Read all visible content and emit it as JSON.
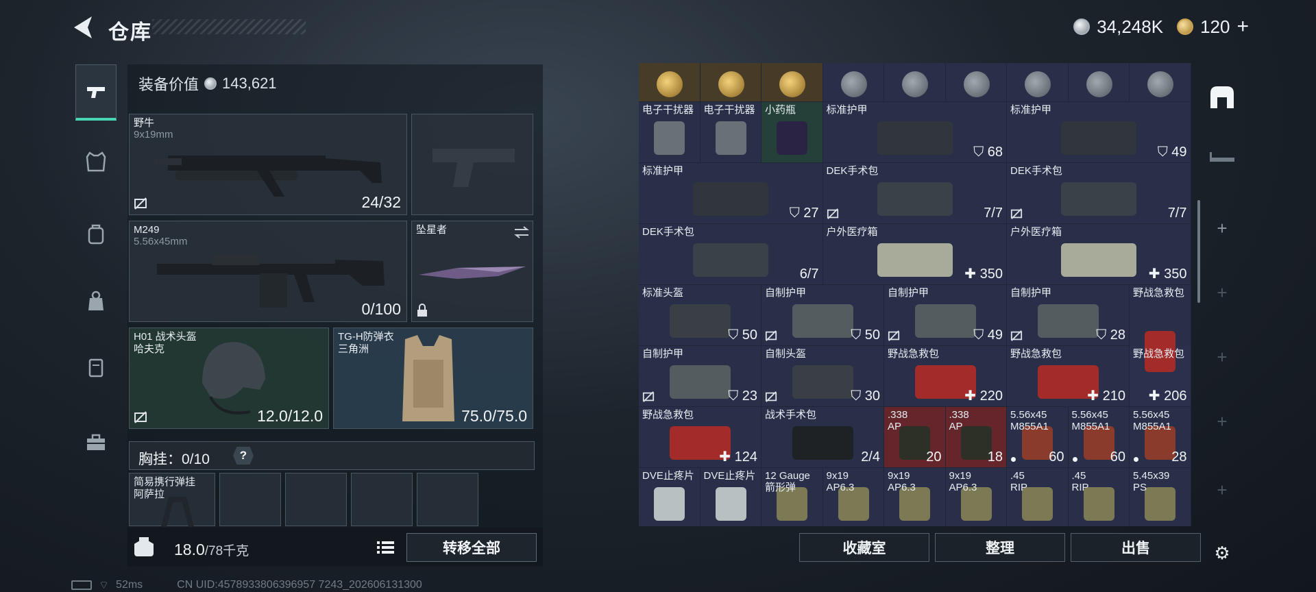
{
  "header": {
    "title": "仓库",
    "currency": {
      "coins": "34,248K",
      "gold": "120"
    }
  },
  "equipment": {
    "value_label": "装备价值",
    "value": "143,621",
    "primary": {
      "name": "野牛",
      "caliber": "9x19mm",
      "ammo": "24/32"
    },
    "secondary": {
      "name": "M249",
      "caliber": "5.56x45mm",
      "ammo": "0/100"
    },
    "melee": {
      "name": "坠星者"
    },
    "helmet": {
      "name": "H01 战术头盔",
      "brand": "哈夫克",
      "durability": "12.0/12.0"
    },
    "armor": {
      "name": "TG-H防弹衣",
      "brand": "三角洲",
      "durability": "75.0/75.0"
    },
    "chest": {
      "label": "胸挂：",
      "capacity": "0/10",
      "help": "?"
    },
    "chest_slot": {
      "name": "简易携行弹挂",
      "brand": "阿萨拉"
    },
    "weight": "18.0",
    "weight_max": "/78千克",
    "transfer_all": "转移全部"
  },
  "storage": {
    "row1": [
      "",
      "",
      "",
      "",
      "",
      "",
      "",
      "",
      ""
    ],
    "items": [
      {
        "name": "电子干扰器",
        "value": ""
      },
      {
        "name": "电子干扰器",
        "value": ""
      },
      {
        "name": "小药瓶",
        "value": ""
      },
      {
        "name": "标准护甲",
        "value": "68"
      },
      {
        "name": "标准护甲",
        "value": "49"
      },
      {
        "name": "标准护甲",
        "value": "27"
      },
      {
        "name": "DEK手术包",
        "value": "7/7"
      },
      {
        "name": "DEK手术包",
        "value": "7/7"
      },
      {
        "name": "DEK手术包",
        "value": "6/7"
      },
      {
        "name": "户外医疗箱",
        "value": "350"
      },
      {
        "name": "户外医疗箱",
        "value": "350"
      },
      {
        "name": "标准头盔",
        "value": "50"
      },
      {
        "name": "自制护甲",
        "value": "50"
      },
      {
        "name": "自制护甲",
        "value": "49"
      },
      {
        "name": "自制护甲",
        "value": "28"
      },
      {
        "name": "野战急救包",
        "value": ""
      },
      {
        "name": "自制护甲",
        "value": "23"
      },
      {
        "name": "自制头盔",
        "value": "30"
      },
      {
        "name": "野战急救包",
        "value": "220"
      },
      {
        "name": "野战急救包",
        "value": "210"
      },
      {
        "name": "野战急救包",
        "value": "206"
      },
      {
        "name": "野战急救包",
        "value": "124"
      },
      {
        "name": "战术手术包",
        "value": "2/4"
      },
      {
        "name": ".338\nAP",
        "value": "20"
      },
      {
        "name": ".338\nAP",
        "value": "18"
      },
      {
        "name": "5.56x45\nM855A1",
        "value": "60"
      },
      {
        "name": "5.56x45\nM855A1",
        "value": "60"
      },
      {
        "name": "5.56x45\nM855A1",
        "value": "28"
      },
      {
        "name": "DVE止疼片",
        "value": ""
      },
      {
        "name": "DVE止疼片",
        "value": ""
      },
      {
        "name": "12 Gauge\n箭形弹",
        "value": ""
      },
      {
        "name": "9x19\nAP6.3",
        "value": ""
      },
      {
        "name": "9x19\nAP6.3",
        "value": ""
      },
      {
        "name": "9x19\nAP6.3",
        "value": ""
      },
      {
        "name": ".45\nRIP",
        "value": ""
      },
      {
        "name": ".45\nRIP",
        "value": ""
      },
      {
        "name": "5.45x39\nPS",
        "value": ""
      }
    ],
    "buttons": {
      "collection": "收藏室",
      "sort": "整理",
      "sell": "出售"
    }
  },
  "status": {
    "ping": "52ms",
    "uid": "CN UID:4578933806396957 7243_202606131300"
  },
  "colors": {
    "accent": "#48d6b5",
    "panel": "#2c323e",
    "red_item": "#6e282a"
  }
}
